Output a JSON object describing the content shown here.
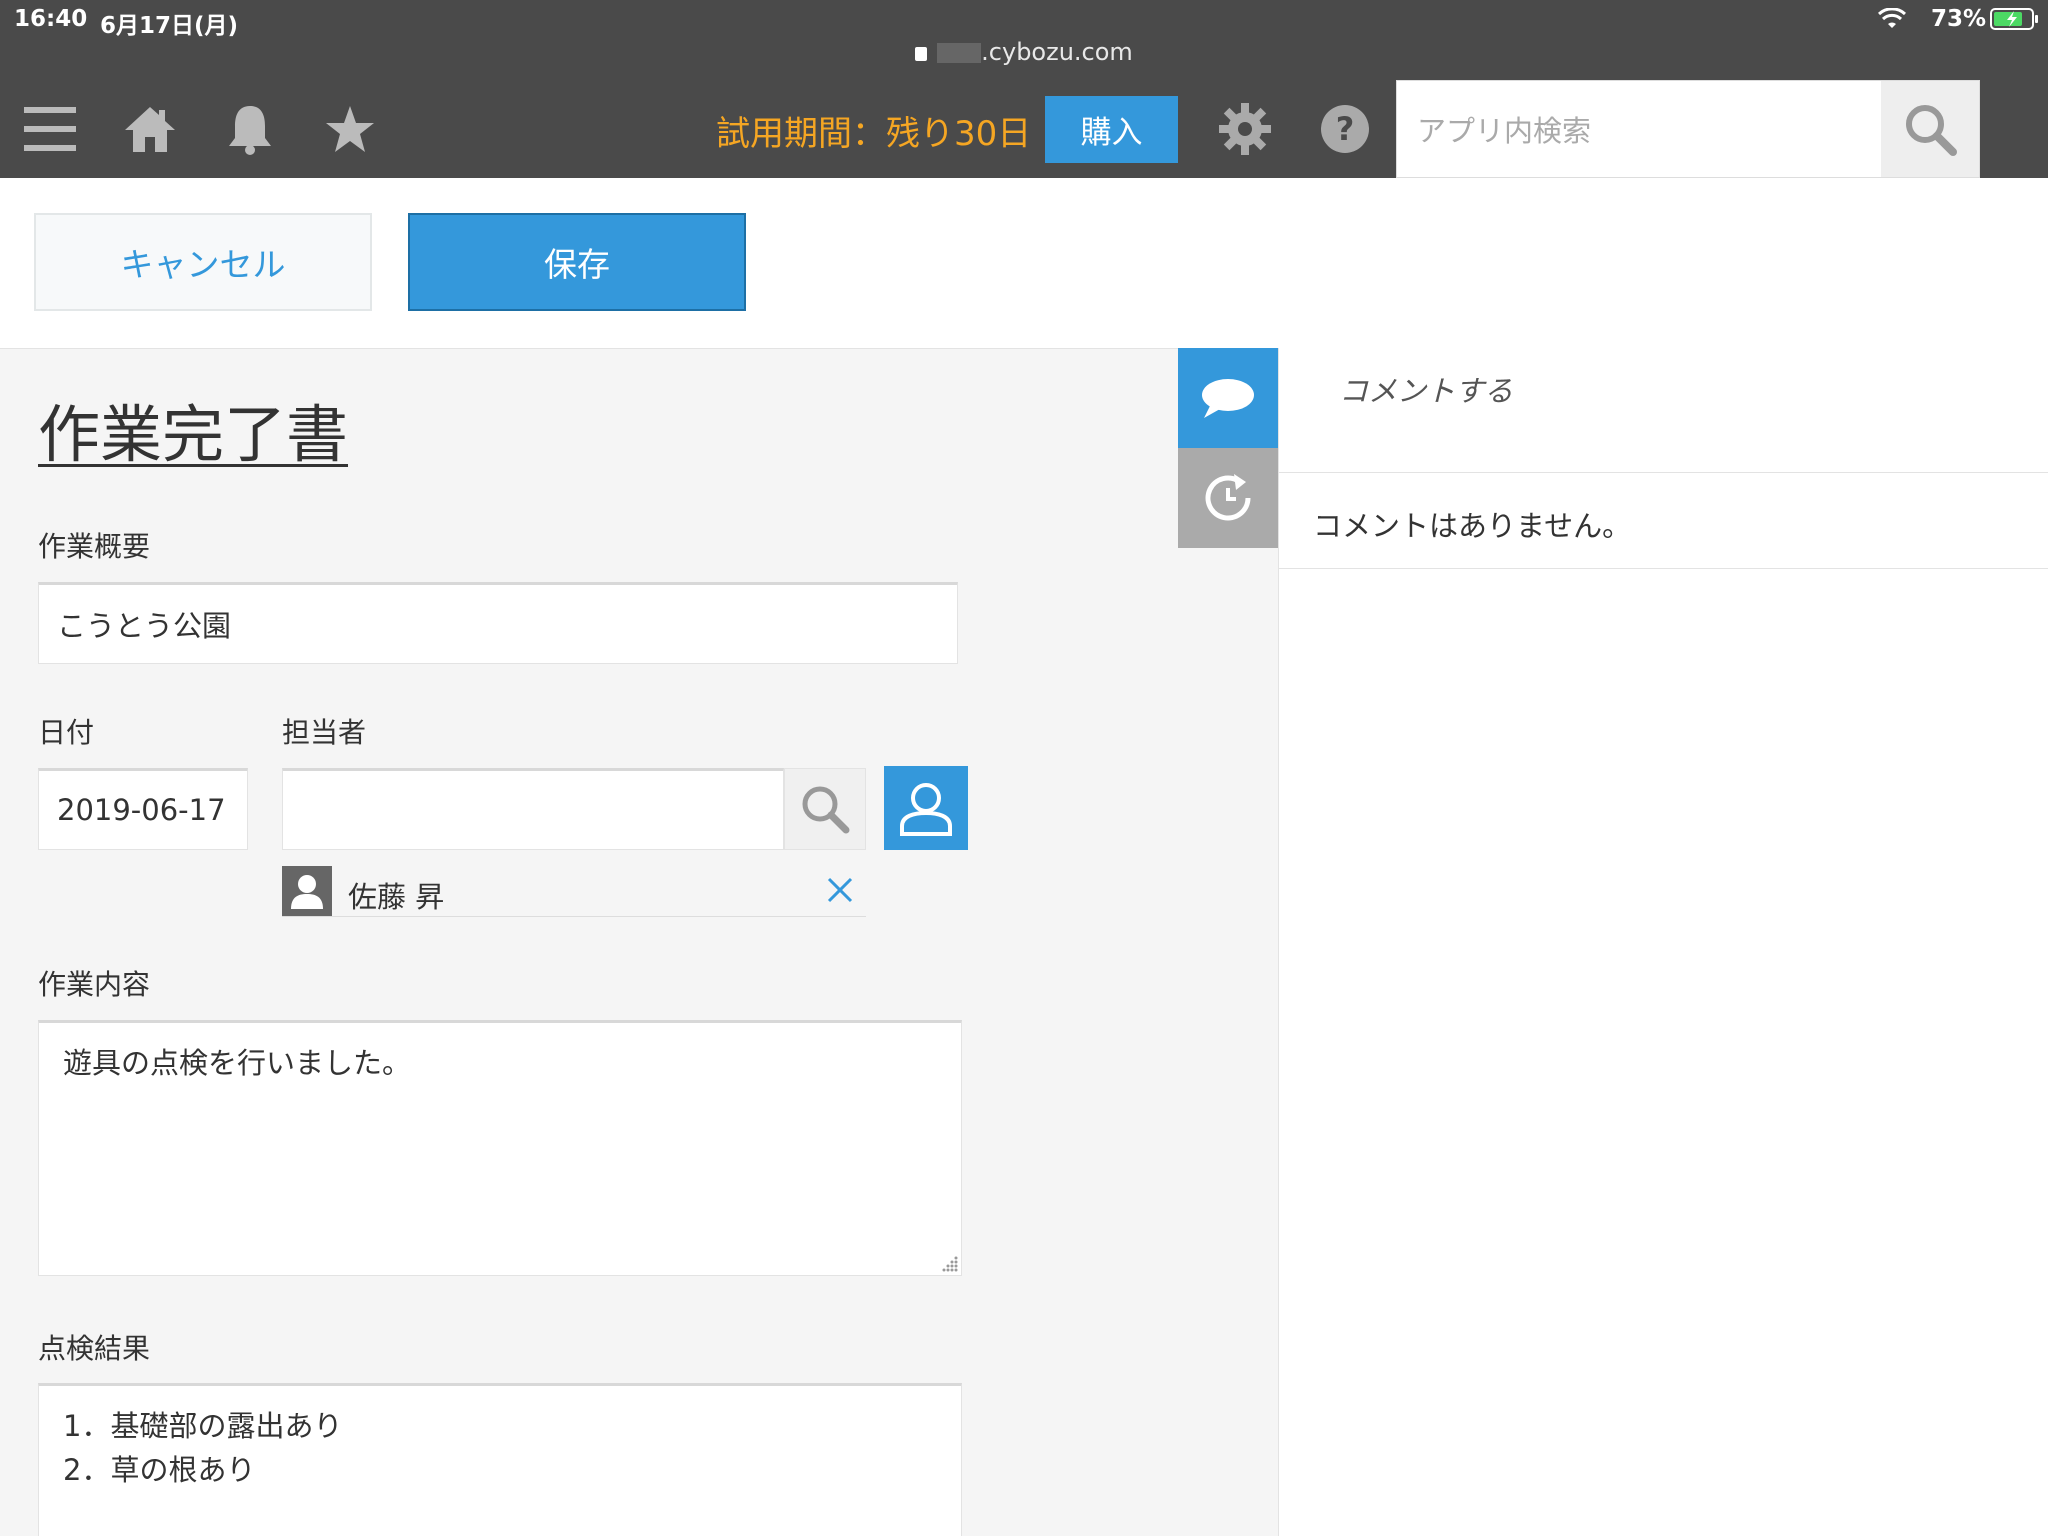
{
  "status_bar": {
    "time": "16:40",
    "date": "6月17日(月)",
    "url": ".cybozu.com",
    "battery": "73%"
  },
  "toolbar": {
    "icons": [
      "menu-icon",
      "home-icon",
      "bell-icon",
      "star-icon",
      "gear-icon",
      "help-icon"
    ],
    "trial_text": "試用期間：残り30日",
    "buy_label": "購入",
    "search_placeholder": "アプリ内検索"
  },
  "actions": {
    "cancel_label": "キャンセル",
    "save_label": "保存"
  },
  "form": {
    "title": "作業完了書",
    "summary": {
      "label": "作業概要",
      "value": "こうとう公園"
    },
    "date": {
      "label": "日付",
      "value": "2019-06-17"
    },
    "assignee": {
      "label": "担当者",
      "input_value": "",
      "selected_user": "佐藤 昇"
    },
    "work_content": {
      "label": "作業内容",
      "value": "遊具の点検を行いました。"
    },
    "inspection": {
      "label": "点検結果",
      "lines": [
        "1．基礎部の露出あり",
        "2．草の根あり"
      ]
    }
  },
  "comments": {
    "action_label": "コメントする",
    "empty_text": "コメントはありません。"
  },
  "colors": {
    "accent": "#3498db",
    "toolbar_bg": "#4a4a4a",
    "trial_text": "#f5a623"
  }
}
